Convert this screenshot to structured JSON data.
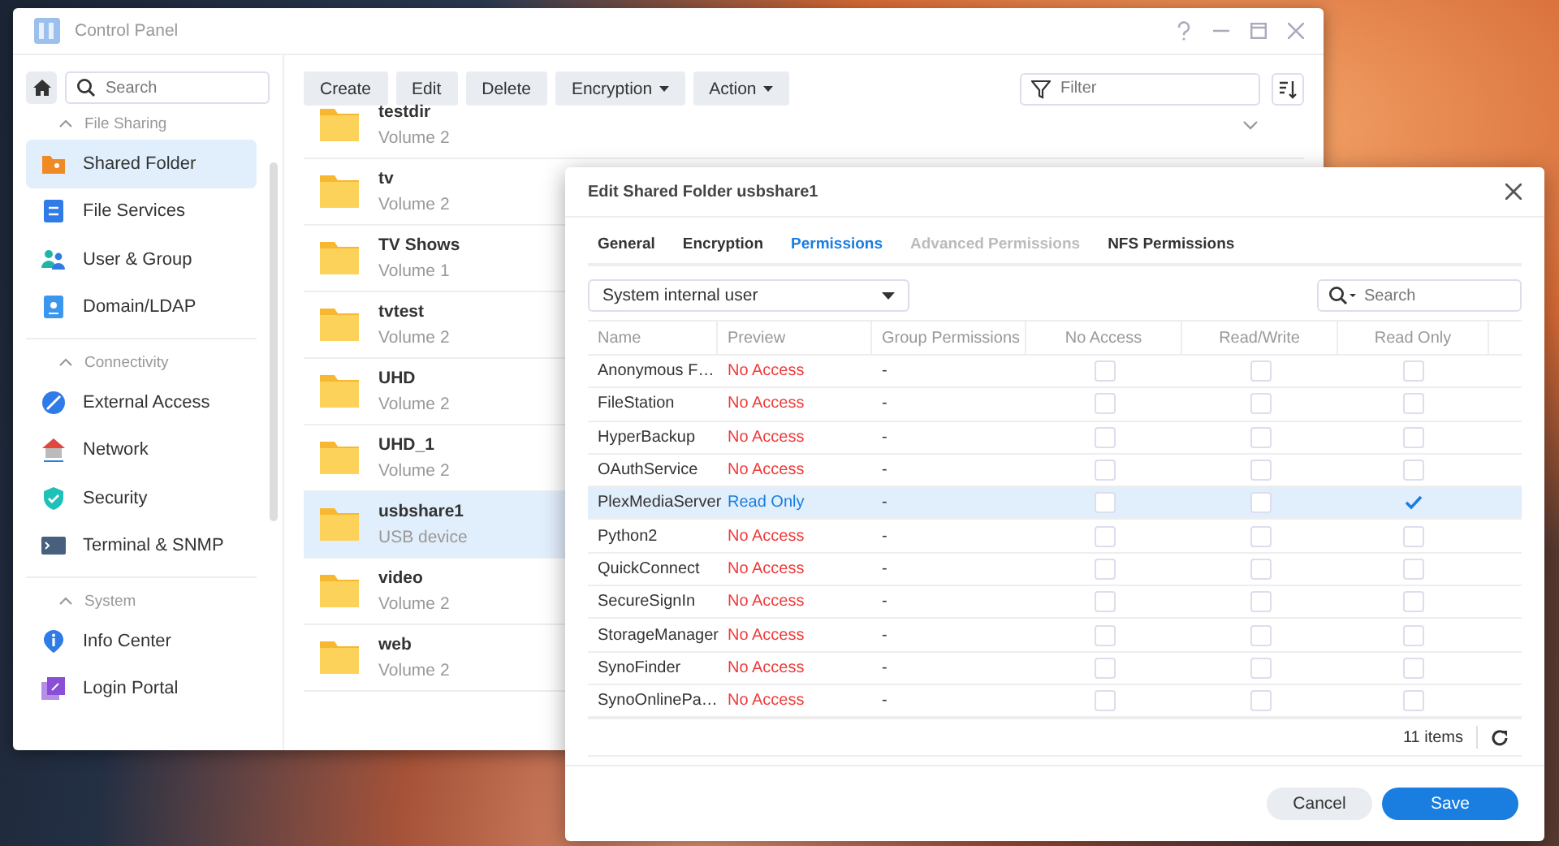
{
  "window": {
    "title": "Control Panel"
  },
  "sidebar": {
    "search": {
      "placeholder": "Search"
    },
    "groups": [
      {
        "title": "File Sharing",
        "expanded": true,
        "items": [
          {
            "label": "Shared Folder",
            "kind": "folder",
            "selected": true
          },
          {
            "label": "File Services",
            "kind": "services",
            "selected": false
          },
          {
            "label": "User & Group",
            "kind": "users",
            "selected": false
          },
          {
            "label": "Domain/LDAP",
            "kind": "domain",
            "selected": false
          }
        ]
      },
      {
        "title": "Connectivity",
        "expanded": true,
        "items": [
          {
            "label": "External Access",
            "kind": "external",
            "selected": false
          },
          {
            "label": "Network",
            "kind": "network",
            "selected": false
          },
          {
            "label": "Security",
            "kind": "security",
            "selected": false
          },
          {
            "label": "Terminal & SNMP",
            "kind": "terminal",
            "selected": false
          }
        ]
      },
      {
        "title": "System",
        "expanded": true,
        "items": [
          {
            "label": "Info Center",
            "kind": "info",
            "selected": false
          },
          {
            "label": "Login Portal",
            "kind": "portal",
            "selected": false
          }
        ]
      }
    ]
  },
  "toolbar": {
    "buttons": [
      {
        "label": "Create",
        "dropdown": false
      },
      {
        "label": "Edit",
        "dropdown": false
      },
      {
        "label": "Delete",
        "dropdown": false
      },
      {
        "label": "Encryption",
        "dropdown": true
      },
      {
        "label": "Action",
        "dropdown": true
      }
    ],
    "filter": {
      "placeholder": "Filter"
    }
  },
  "folders": [
    {
      "name": "testdir",
      "location": "Volume 2",
      "selected": false
    },
    {
      "name": "tv",
      "location": "Volume 2",
      "selected": false
    },
    {
      "name": "TV Shows",
      "location": "Volume 1",
      "selected": false
    },
    {
      "name": "tvtest",
      "location": "Volume 2",
      "selected": false
    },
    {
      "name": "UHD",
      "location": "Volume 2",
      "selected": false
    },
    {
      "name": "UHD_1",
      "location": "Volume 2",
      "selected": false
    },
    {
      "name": "usbshare1",
      "location": "USB device",
      "selected": true
    },
    {
      "name": "video",
      "location": "Volume 2",
      "selected": false
    },
    {
      "name": "web",
      "location": "Volume 2",
      "selected": false
    }
  ],
  "dialog": {
    "title": "Edit Shared Folder usbshare1",
    "tabs": [
      {
        "label": "General",
        "selected": false,
        "disabled": false
      },
      {
        "label": "Encryption",
        "selected": false,
        "disabled": false
      },
      {
        "label": "Permissions",
        "selected": true,
        "disabled": false
      },
      {
        "label": "Advanced Permissions",
        "selected": false,
        "disabled": true
      },
      {
        "label": "NFS Permissions",
        "selected": false,
        "disabled": false
      }
    ],
    "user_type": "System internal user",
    "search": {
      "placeholder": "Search"
    },
    "columns": [
      "Name",
      "Preview",
      "Group Permissions",
      "No Access",
      "Read/Write",
      "Read Only"
    ],
    "rows": [
      {
        "name": "Anonymous F…",
        "preview": "No Access",
        "group": "-",
        "no_access": false,
        "read_write": false,
        "read_only": false,
        "selected": false
      },
      {
        "name": "FileStation",
        "preview": "No Access",
        "group": "-",
        "no_access": false,
        "read_write": false,
        "read_only": false,
        "selected": false
      },
      {
        "name": "HyperBackup",
        "preview": "No Access",
        "group": "-",
        "no_access": false,
        "read_write": false,
        "read_only": false,
        "selected": false
      },
      {
        "name": "OAuthService",
        "preview": "No Access",
        "group": "-",
        "no_access": false,
        "read_write": false,
        "read_only": false,
        "selected": false
      },
      {
        "name": "PlexMediaServer",
        "preview": "Read Only",
        "group": "-",
        "no_access": false,
        "read_write": false,
        "read_only": true,
        "selected": true
      },
      {
        "name": "Python2",
        "preview": "No Access",
        "group": "-",
        "no_access": false,
        "read_write": false,
        "read_only": false,
        "selected": false
      },
      {
        "name": "QuickConnect",
        "preview": "No Access",
        "group": "-",
        "no_access": false,
        "read_write": false,
        "read_only": false,
        "selected": false
      },
      {
        "name": "SecureSignIn",
        "preview": "No Access",
        "group": "-",
        "no_access": false,
        "read_write": false,
        "read_only": false,
        "selected": false
      },
      {
        "name": "StorageManager",
        "preview": "No Access",
        "group": "-",
        "no_access": false,
        "read_write": false,
        "read_only": false,
        "selected": false
      },
      {
        "name": "SynoFinder",
        "preview": "No Access",
        "group": "-",
        "no_access": false,
        "read_write": false,
        "read_only": false,
        "selected": false
      },
      {
        "name": "SynoOnlinePa…",
        "preview": "No Access",
        "group": "-",
        "no_access": false,
        "read_write": false,
        "read_only": false,
        "selected": false
      }
    ],
    "item_count": "11 items",
    "buttons": [
      {
        "label": "Cancel",
        "kind": "secondary"
      },
      {
        "label": "Save",
        "kind": "primary"
      }
    ]
  }
}
